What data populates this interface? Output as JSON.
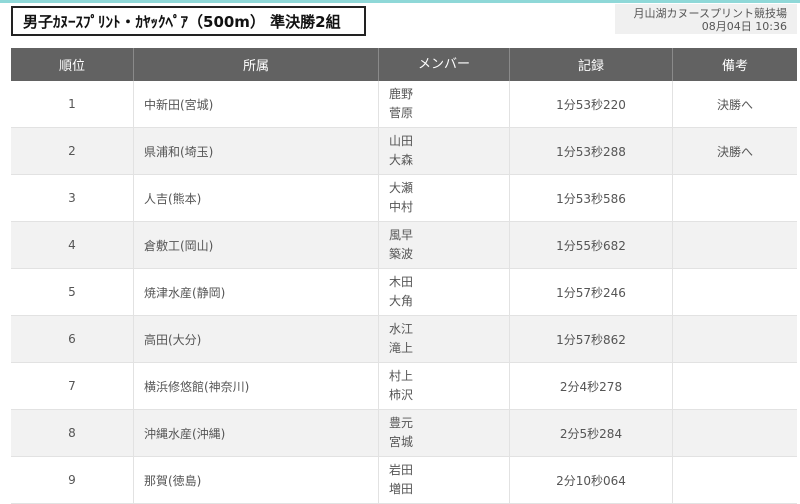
{
  "title": "男子ｶﾇｰｽﾌﾟﾘﾝﾄ・ｶﾔｯｸﾍﾟｱ（500m） 準決勝2組",
  "venue": "月山湖カヌースプリント競技場",
  "datetime": "08月04日 10:36",
  "colors": {
    "header_bg": "#626262",
    "accent_top": "#8fd8d8",
    "alt_row": "#f2f2f2"
  },
  "headers": {
    "rank": "順位",
    "affiliation": "所属",
    "members": "メンバー",
    "record": "記録",
    "note": "備考"
  },
  "rows": [
    {
      "rank": "1",
      "affiliation": "中新田(宮城)",
      "member1": "鹿野",
      "member2": "菅原",
      "record": "1分53秒220",
      "note": "決勝へ"
    },
    {
      "rank": "2",
      "affiliation": "県浦和(埼玉)",
      "member1": "山田",
      "member2": "大森",
      "record": "1分53秒288",
      "note": "決勝へ"
    },
    {
      "rank": "3",
      "affiliation": "人吉(熊本)",
      "member1": "大瀬",
      "member2": "中村",
      "record": "1分53秒586",
      "note": ""
    },
    {
      "rank": "4",
      "affiliation": "倉敷工(岡山)",
      "member1": "風早",
      "member2": "築波",
      "record": "1分55秒682",
      "note": ""
    },
    {
      "rank": "5",
      "affiliation": "焼津水産(静岡)",
      "member1": "木田",
      "member2": "大角",
      "record": "1分57秒246",
      "note": ""
    },
    {
      "rank": "6",
      "affiliation": "高田(大分)",
      "member1": "水江",
      "member2": "滝上",
      "record": "1分57秒862",
      "note": ""
    },
    {
      "rank": "7",
      "affiliation": "横浜修悠館(神奈川)",
      "member1": "村上",
      "member2": "柿沢",
      "record": "2分4秒278",
      "note": ""
    },
    {
      "rank": "8",
      "affiliation": "沖縄水産(沖縄)",
      "member1": "豊元",
      "member2": "宮城",
      "record": "2分5秒284",
      "note": ""
    },
    {
      "rank": "9",
      "affiliation": "那賀(徳島)",
      "member1": "岩田",
      "member2": "増田",
      "record": "2分10秒064",
      "note": ""
    }
  ]
}
